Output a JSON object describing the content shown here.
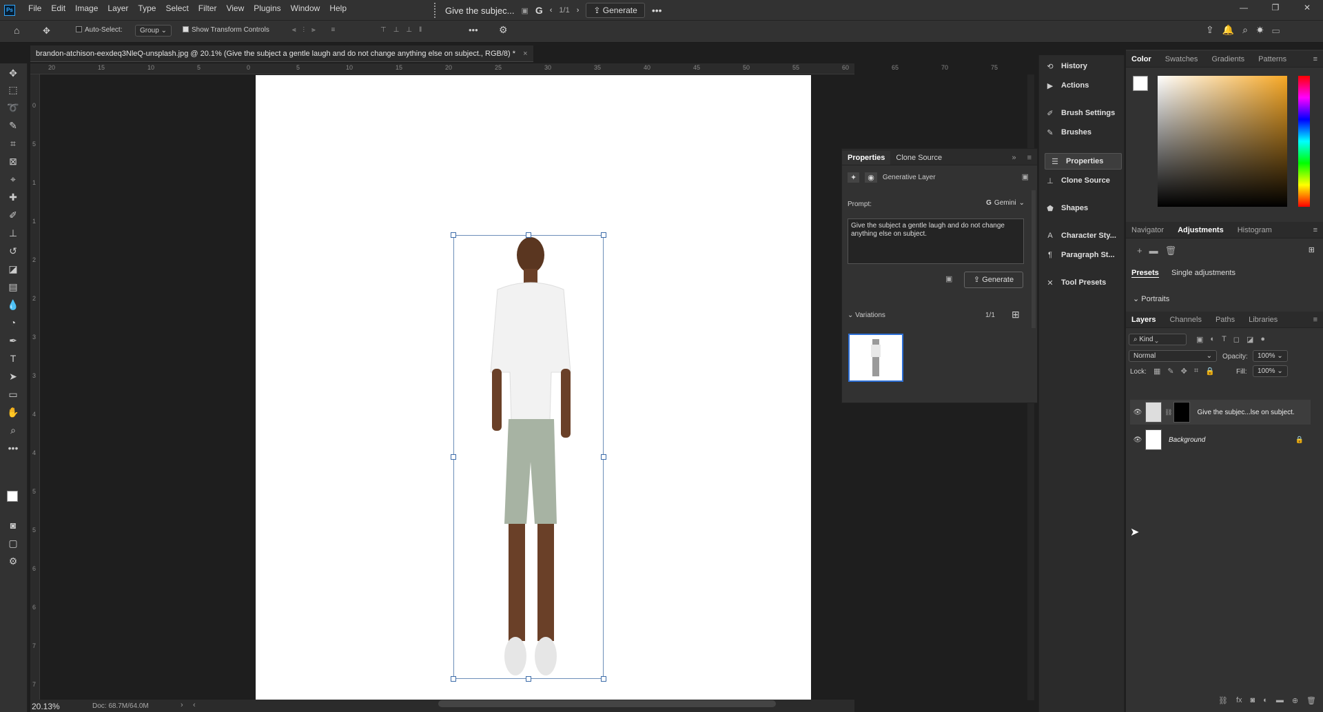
{
  "app": {
    "logo": "Ps",
    "menus": [
      "File",
      "Edit",
      "Image",
      "Layer",
      "Type",
      "Select",
      "Filter",
      "View",
      "Plugins",
      "Window",
      "Help"
    ]
  },
  "contextual": {
    "prompt_preview": "Give the subjec...",
    "page": "1/1",
    "generate": "Generate"
  },
  "options": {
    "auto_select": "Auto-Select:",
    "group": "Group",
    "show_transform": "Show Transform Controls"
  },
  "document": {
    "tab_title": "brandon-atchison-eexdeq3NleQ-unsplash.jpg @ 20.1% (Give the subject a gentle laugh and do not change anything else on subject., RGB/8) *",
    "close": "×"
  },
  "ruler": {
    "h": [
      "20",
      "15",
      "10",
      "5",
      "0",
      "5",
      "10",
      "15",
      "20",
      "25",
      "30",
      "35",
      "40",
      "45",
      "50",
      "55",
      "60",
      "65",
      "70",
      "75"
    ],
    "v": [
      "0",
      "5",
      "1",
      "1",
      "2",
      "2",
      "3",
      "3",
      "4",
      "4",
      "5",
      "5",
      "6",
      "6",
      "7",
      "7"
    ]
  },
  "status": {
    "zoom": "20.13%",
    "doc": "Doc: 68.7M/64.0M"
  },
  "properties": {
    "tabs": [
      "Properties",
      "Clone Source"
    ],
    "layer_type": "Generative Layer",
    "prompt_label": "Prompt:",
    "model": "Gemini",
    "prompt_text": "Give the subject a gentle laugh and do not change anything else on subject.",
    "generate": "Generate",
    "variations_label": "Variations",
    "variations_count": "1/1"
  },
  "dock": [
    "History",
    "Actions",
    "Brush Settings",
    "Brushes",
    "Properties",
    "Clone Source",
    "Shapes",
    "Character Sty...",
    "Paragraph St...",
    "Tool Presets"
  ],
  "color_panel": {
    "tabs": [
      "Color",
      "Swatches",
      "Gradients",
      "Patterns"
    ]
  },
  "adjust_panel": {
    "tabs": [
      "Navigator",
      "Adjustments",
      "Histogram"
    ],
    "subtabs": [
      "Presets",
      "Single adjustments"
    ],
    "group": "Portraits"
  },
  "layers_panel": {
    "tabs": [
      "Layers",
      "Channels",
      "Paths",
      "Libraries"
    ],
    "kind": "Kind",
    "blend": "Normal",
    "opacity_label": "Opacity:",
    "opacity": "100%",
    "lock_label": "Lock:",
    "fill_label": "Fill:",
    "fill": "100%",
    "layers": [
      {
        "name": "Give the subjec...lse on subject."
      },
      {
        "name": "Background"
      }
    ]
  }
}
